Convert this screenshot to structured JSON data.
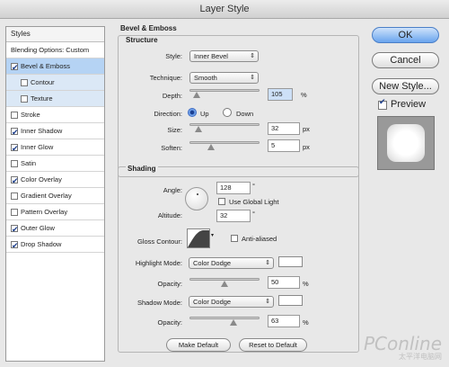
{
  "window": {
    "title": "Layer Style"
  },
  "styles_list": {
    "header": "Styles",
    "items": [
      {
        "label": "Blending Options: Custom",
        "checkbox": false,
        "checked": false,
        "selected": false,
        "sub": false
      },
      {
        "label": "Bevel & Emboss",
        "checkbox": true,
        "checked": true,
        "selected": true,
        "sub": false
      },
      {
        "label": "Contour",
        "checkbox": true,
        "checked": false,
        "selected": false,
        "sub": true
      },
      {
        "label": "Texture",
        "checkbox": true,
        "checked": false,
        "selected": false,
        "sub": true
      },
      {
        "label": "Stroke",
        "checkbox": true,
        "checked": false,
        "selected": false,
        "sub": false
      },
      {
        "label": "Inner Shadow",
        "checkbox": true,
        "checked": true,
        "selected": false,
        "sub": false
      },
      {
        "label": "Inner Glow",
        "checkbox": true,
        "checked": true,
        "selected": false,
        "sub": false
      },
      {
        "label": "Satin",
        "checkbox": true,
        "checked": false,
        "selected": false,
        "sub": false
      },
      {
        "label": "Color Overlay",
        "checkbox": true,
        "checked": true,
        "selected": false,
        "sub": false
      },
      {
        "label": "Gradient Overlay",
        "checkbox": true,
        "checked": false,
        "selected": false,
        "sub": false
      },
      {
        "label": "Pattern Overlay",
        "checkbox": true,
        "checked": false,
        "selected": false,
        "sub": false
      },
      {
        "label": "Outer Glow",
        "checkbox": true,
        "checked": true,
        "selected": false,
        "sub": false
      },
      {
        "label": "Drop Shadow",
        "checkbox": true,
        "checked": true,
        "selected": false,
        "sub": false
      }
    ]
  },
  "bevel": {
    "title": "Bevel & Emboss",
    "structure": {
      "title": "Structure",
      "style_label": "Style:",
      "style_value": "Inner Bevel",
      "technique_label": "Technique:",
      "technique_value": "Smooth",
      "depth_label": "Depth:",
      "depth_value": "105",
      "depth_unit": "%",
      "depth_level": 0.105,
      "direction_label": "Direction:",
      "direction_up": "Up",
      "direction_down": "Down",
      "size_label": "Size:",
      "size_value": "32",
      "size_unit": "px",
      "size_level": 0.128,
      "soften_label": "Soften:",
      "soften_value": "5",
      "soften_unit": "px",
      "soften_level": 0.3125
    },
    "shading": {
      "title": "Shading",
      "angle_label": "Angle:",
      "angle_value": "128",
      "angle_unit": "°",
      "global_light_label": "Use Global Light",
      "altitude_label": "Altitude:",
      "altitude_value": "32",
      "altitude_unit": "°",
      "gloss_label": "Gloss Contour:",
      "antialiased_label": "Anti-aliased",
      "highlight_mode_label": "Highlight Mode:",
      "highlight_mode_value": "Color Dodge",
      "highlight_opacity_label": "Opacity:",
      "highlight_opacity_value": "50",
      "highlight_opacity_unit": "%",
      "highlight_opacity_level": 0.5,
      "shadow_mode_label": "Shadow Mode:",
      "shadow_mode_value": "Color Dodge",
      "shadow_opacity_label": "Opacity:",
      "shadow_opacity_value": "63",
      "shadow_opacity_unit": "%",
      "shadow_opacity_level": 0.63,
      "highlight_color": "#ffffff",
      "shadow_color": "#ffffff"
    },
    "make_default": "Make Default",
    "reset_default": "Reset to Default"
  },
  "buttons": {
    "ok": "OK",
    "cancel": "Cancel",
    "new_style": "New Style...",
    "preview": "Preview"
  },
  "watermark": {
    "brand": "PConline",
    "sub": "太平洋电脑网"
  }
}
